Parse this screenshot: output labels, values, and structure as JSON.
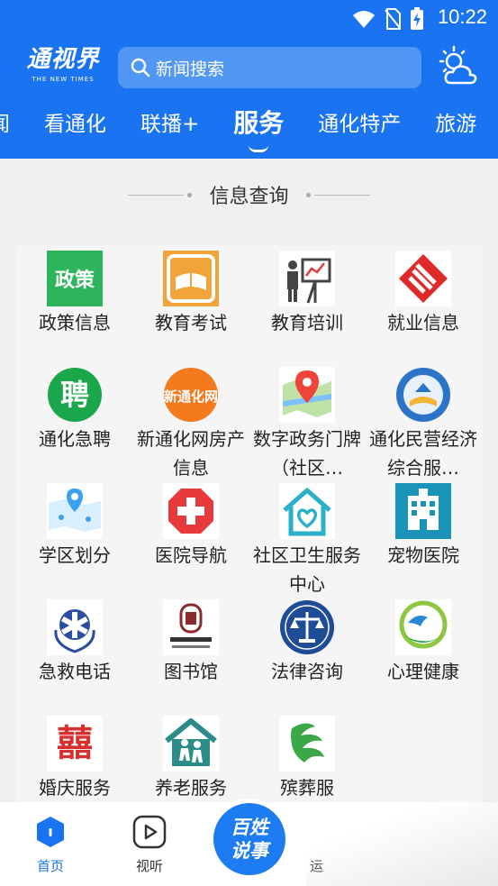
{
  "status_bar": {
    "time": "10:22"
  },
  "header": {
    "logo_main": "通视界",
    "logo_sub": "THE NEW TIMES",
    "search_placeholder": "新闻搜索",
    "tabs": [
      "闻",
      "看通化",
      "联播+",
      "服务",
      "通化特产",
      "旅游"
    ],
    "active_tab": "服务"
  },
  "section": {
    "title": "信息查询"
  },
  "services": [
    {
      "label": "政策信息",
      "icon": "policy-icon"
    },
    {
      "label": "教育考试",
      "icon": "book-exam-icon"
    },
    {
      "label": "教育培训",
      "icon": "teacher-board-icon"
    },
    {
      "label": "就业信息",
      "icon": "employment-icon"
    },
    {
      "label": "通化急聘",
      "icon": "recruit-icon"
    },
    {
      "label": "新通化网房产信息",
      "icon": "real-estate-icon"
    },
    {
      "label": "数字政务门牌（社区…",
      "icon": "map-pin-icon"
    },
    {
      "label": "通化民营经济综合服…",
      "icon": "private-economy-icon"
    },
    {
      "label": "学区划分",
      "icon": "school-district-icon"
    },
    {
      "label": "医院导航",
      "icon": "hospital-cross-icon"
    },
    {
      "label": "社区卫生服务中心",
      "icon": "community-health-icon"
    },
    {
      "label": "宠物医院",
      "icon": "pet-hospital-icon"
    },
    {
      "label": "急救电话",
      "icon": "emergency-icon"
    },
    {
      "label": "图书馆",
      "icon": "library-icon"
    },
    {
      "label": "法律咨询",
      "icon": "law-scale-icon"
    },
    {
      "label": "心理健康",
      "icon": "mental-health-icon"
    },
    {
      "label": "婚庆服务",
      "icon": "wedding-icon"
    },
    {
      "label": "养老服务",
      "icon": "elderly-care-icon"
    },
    {
      "label": "殡葬服",
      "icon": "funeral-icon"
    }
  ],
  "bottom_nav": {
    "home": "首页",
    "video": "视听",
    "center_line1": "百姓",
    "center_line2": "说事",
    "partial": "运"
  },
  "colors": {
    "brand_blue": "#1a73f0"
  }
}
